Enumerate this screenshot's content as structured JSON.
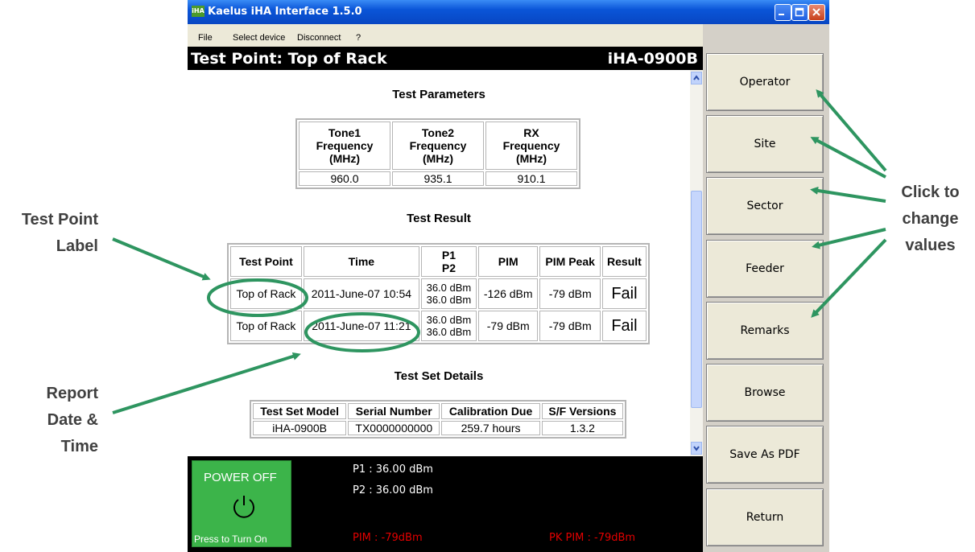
{
  "window": {
    "title": "Kaelus iHA Interface 1.5.0",
    "app_icon_text": "iHA"
  },
  "menu": [
    "File",
    "Select device",
    "Disconnect",
    "?"
  ],
  "header": {
    "title": "Test Point: Top of Rack",
    "device": "iHA-0900B"
  },
  "test_parameters": {
    "title": "Test Parameters",
    "headers": [
      [
        "Tone1",
        "Frequency",
        "(MHz)"
      ],
      [
        "Tone2",
        "Frequency",
        "(MHz)"
      ],
      [
        "RX",
        "Frequency",
        "(MHz)"
      ]
    ],
    "values": [
      "960.0",
      "935.1",
      "910.1"
    ]
  },
  "test_result": {
    "title": "Test Result",
    "headers": [
      "Test Point",
      "Time",
      "P1",
      "P2",
      "PIM",
      "PIM Peak",
      "Result"
    ],
    "rows": [
      {
        "test_point": "Top of Rack",
        "time": "2011-June-07 10:54",
        "p1": "36.0 dBm",
        "p2": "36.0 dBm",
        "pim": "-126 dBm",
        "pim_peak": "-79 dBm",
        "result": "Fail"
      },
      {
        "test_point": "Top of Rack",
        "time": "2011-June-07 11:21",
        "p1": "36.0 dBm",
        "p2": "36.0 dBm",
        "pim": "-79 dBm",
        "pim_peak": "-79 dBm",
        "result": "Fail"
      }
    ]
  },
  "test_set_details": {
    "title": "Test Set Details",
    "headers": [
      "Test Set Model",
      "Serial Number",
      "Calibration Due",
      "S/F Versions"
    ],
    "values": [
      "iHA-0900B",
      "TX0000000000",
      "259.7 hours",
      "1.3.2"
    ]
  },
  "status": {
    "power_label": "POWER OFF",
    "power_hint": "Press to Turn On",
    "p1": "P1 : 36.00 dBm",
    "p2": "P2 : 36.00 dBm",
    "pim": "PIM : -79dBm",
    "pk_pim": "PK PIM : -79dBm",
    "alert_color": "#e30000"
  },
  "side_buttons": [
    "Operator",
    "Site",
    "Sector",
    "Feeder",
    "Remarks",
    "Browse",
    "Save As PDF",
    "Return"
  ],
  "annotations": {
    "test_point_label": [
      "Test Point",
      "Label"
    ],
    "report_date_time": [
      "Report",
      "Date &",
      "Time"
    ],
    "click_to_change": [
      "Click to",
      "change",
      "values"
    ],
    "accent_color": "#2e9560"
  }
}
